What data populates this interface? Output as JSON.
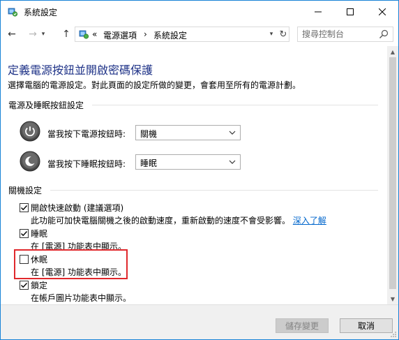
{
  "window": {
    "title": "系統設定",
    "minimize_label": "—",
    "maximize_label": "☐",
    "close_label": "✕"
  },
  "nav": {
    "back_icon": "←",
    "forward_icon": "→",
    "up_icon": "↑",
    "breadcrumb_prefix": "«",
    "breadcrumb_1": "電源選項",
    "breadcrumb_sep": "›",
    "breadcrumb_2": "系統設定",
    "refresh_icon": "↻",
    "search_placeholder": "搜尋控制台"
  },
  "page": {
    "title": "定義電源按鈕並開啟密碼保護",
    "description": "選擇電腦的電源設定。對此頁面的設定所做的變更，會套用至所有的電源計劃。"
  },
  "power_buttons": {
    "group_label": "電源及睡眠按鈕設定",
    "power_label": "當我按下電源按鈕時:",
    "power_value": "關機",
    "sleep_label": "當我按下睡眠按鈕時:",
    "sleep_value": "睡眠"
  },
  "shutdown": {
    "group_label": "關機設定",
    "items": [
      {
        "label": "開啟快速啟動 (建議選項)",
        "desc": "此功能可加快電腦關機之後的啟動速度，重新啟動的速度不會受影響。",
        "link": "深入了解",
        "checked": true
      },
      {
        "label": "睡眠",
        "desc": "在 [電源] 功能表中顯示。",
        "checked": true
      },
      {
        "label": "休眠",
        "desc": "在 [電源] 功能表中顯示。",
        "checked": false
      },
      {
        "label": "鎖定",
        "desc": "在帳戶圖片功能表中顯示。",
        "checked": true
      }
    ]
  },
  "footer": {
    "save_label": "儲存變更",
    "cancel_label": "取消"
  },
  "colors": {
    "title_blue": "#1e3287",
    "link_blue": "#0066cc",
    "highlight_red": "#e0282c",
    "window_border": "#1883d7"
  }
}
